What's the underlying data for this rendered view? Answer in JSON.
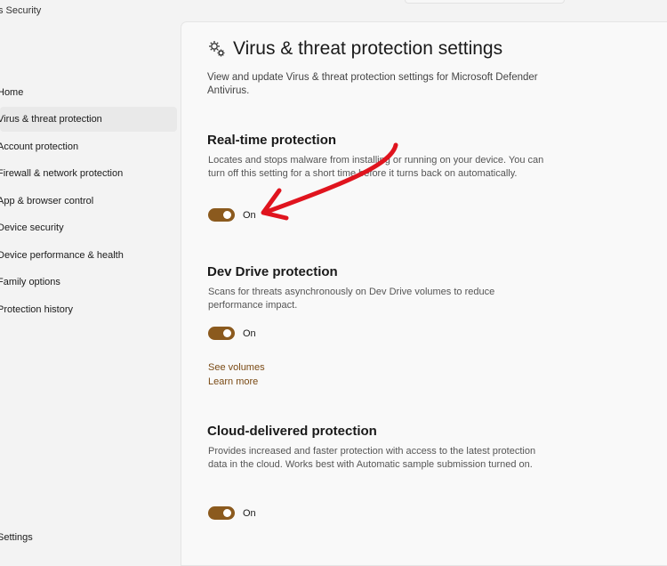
{
  "window": {
    "title": "ws Security"
  },
  "sidebar": {
    "items": [
      {
        "label": "Home",
        "selected": false
      },
      {
        "label": "Virus & threat protection",
        "selected": true
      },
      {
        "label": "Account protection",
        "selected": false
      },
      {
        "label": "Firewall & network protection",
        "selected": false
      },
      {
        "label": "App & browser control",
        "selected": false
      },
      {
        "label": "Device security",
        "selected": false
      },
      {
        "label": "Device performance & health",
        "selected": false
      },
      {
        "label": "Family options",
        "selected": false
      },
      {
        "label": "Protection history",
        "selected": false
      }
    ],
    "settings_label": "Settings"
  },
  "main": {
    "title": "Virus & threat protection settings",
    "title_icon": "gears-icon",
    "description": "View and update Virus & threat protection settings for Microsoft Defender Antivirus.",
    "sections": [
      {
        "title": "Real-time protection",
        "description": "Locates and stops malware from installing or running on your device. You can turn off this setting for a short time before it turns back on automatically.",
        "toggle_state": "On"
      },
      {
        "title": "Dev Drive protection",
        "description": "Scans for threats asynchronously on Dev Drive volumes to reduce performance impact.",
        "toggle_state": "On",
        "links": [
          "See volumes",
          "Learn more"
        ]
      },
      {
        "title": "Cloud-delivered protection",
        "description": "Provides increased and faster protection with access to the latest protection data in the cloud. Works best with Automatic sample submission turned on.",
        "toggle_state": "On"
      }
    ]
  },
  "colors": {
    "accent": "#8b5a1e",
    "link": "#7a4a14",
    "annotation": "#e0141e"
  }
}
